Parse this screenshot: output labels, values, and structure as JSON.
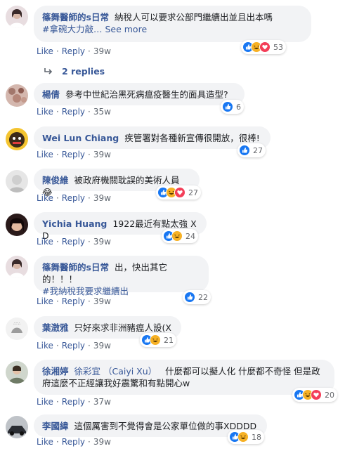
{
  "actions": {
    "like": "Like",
    "reply": "Reply",
    "dot": "·"
  },
  "colors": {
    "link": "#385898",
    "bubble": "#f2f3f5",
    "like": "#1877f2",
    "love": "#f33e58",
    "haha": "#f7b125"
  },
  "comments": [
    {
      "author": "篠舞醫師的s日常",
      "text": "納稅人可以要求公部門繼續出並且出本嗎",
      "tag": "#拿碗大力敲…",
      "see_more": "See more",
      "time": "39w",
      "reactions": [
        "haha",
        "like",
        "love"
      ],
      "count": "53"
    },
    {
      "author": "楊倩",
      "text": "參考中世紀治黑死病瘟疫醫生的面具造型?",
      "time": "35w",
      "reactions": [
        "like"
      ],
      "count": "6",
      "replies": "2 replies"
    },
    {
      "author": "Wei Lun Chiang",
      "text": "疾管署對各種新宣傳很開放，很棒!",
      "time": "39w",
      "reactions": [
        "like"
      ],
      "count": "27"
    },
    {
      "author": "陳俊維",
      "text": "被政府機關耽誤的美術人員",
      "emoji": "😂",
      "time": "39w",
      "reactions": [
        "like",
        "haha",
        "love"
      ],
      "count": "27"
    },
    {
      "author": "Yichia Huang",
      "text": "1922最近有點太強 X D",
      "time": "39w",
      "reactions": [
        "like",
        "haha"
      ],
      "count": "24"
    },
    {
      "author": "篠舞醫師的s日常",
      "text": "出，快出其它的！！！",
      "tag": "#我納稅我要求繼續出",
      "time": "39w",
      "reactions": [
        "like"
      ],
      "count": "22"
    },
    {
      "author": "葉澂雅",
      "text": "只好來求非洲豬瘟人設(X",
      "time": "39w",
      "reactions": [
        "like",
        "haha"
      ],
      "count": "21"
    },
    {
      "author": "徐湘婷",
      "mention": "徐彩宜 （Caiyi Xu）",
      "text": "什麼都可以擬人化 什麼都不奇怪 但是政府這麼不正經讓我好震驚和有點開心w",
      "time": "37w",
      "reactions": [
        "like",
        "haha",
        "love"
      ],
      "count": "20"
    },
    {
      "author": "李國緯",
      "text": "這個厲害到不覺得會是公家單位做的事XDDDD",
      "time": "39w",
      "reactions": [
        "like",
        "haha"
      ],
      "count": "18"
    }
  ]
}
